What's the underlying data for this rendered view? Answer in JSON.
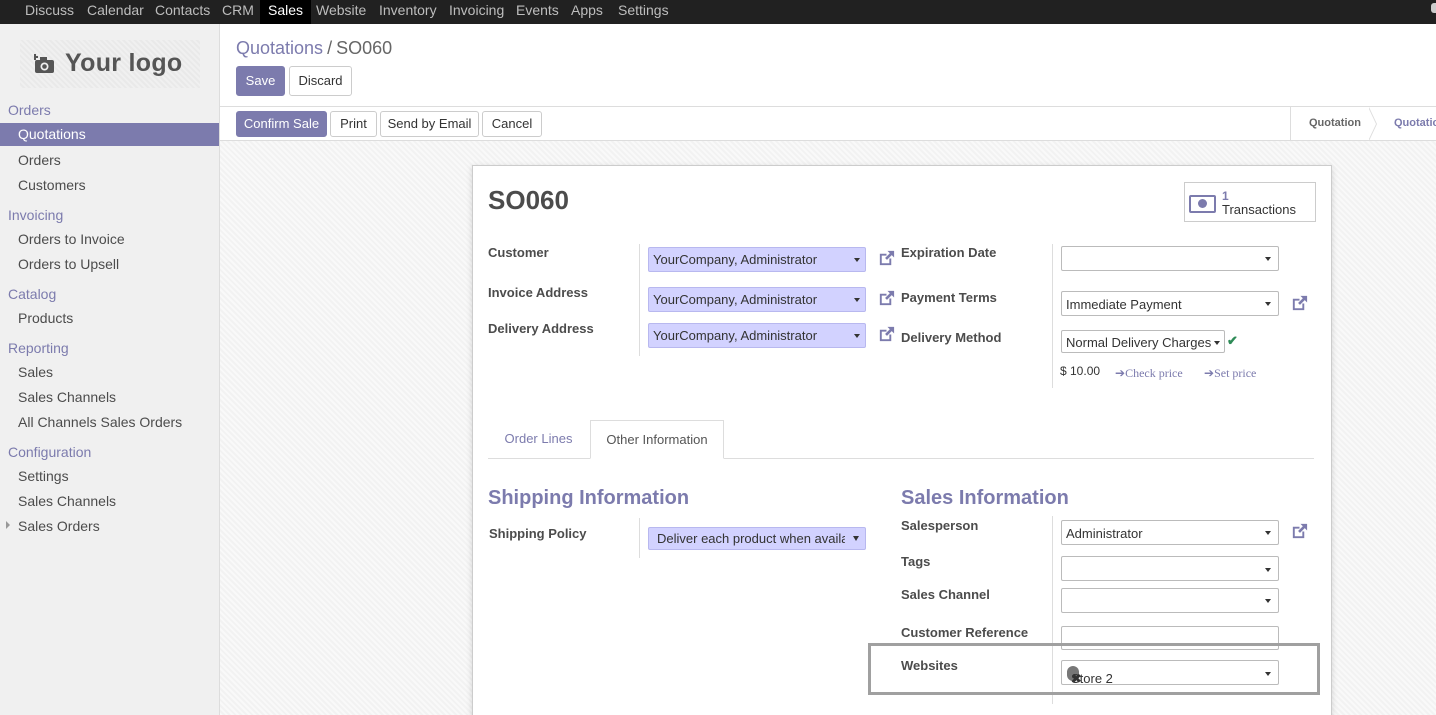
{
  "topnav": {
    "items": [
      "Discuss",
      "Calendar",
      "Contacts",
      "CRM",
      "Sales",
      "Website",
      "Inventory",
      "Invoicing",
      "Events",
      "Apps",
      "Settings"
    ],
    "active": "Sales"
  },
  "logo": {
    "text": "Your logo"
  },
  "sidebar": {
    "sections": [
      {
        "title": "Orders",
        "items": [
          "Quotations",
          "Orders",
          "Customers"
        ]
      },
      {
        "title": "Invoicing",
        "items": [
          "Orders to Invoice",
          "Orders to Upsell"
        ]
      },
      {
        "title": "Catalog",
        "items": [
          "Products"
        ]
      },
      {
        "title": "Reporting",
        "items": [
          "Sales",
          "Sales Channels",
          "All Channels Sales Orders"
        ]
      },
      {
        "title": "Configuration",
        "items": [
          "Settings",
          "Sales Channels",
          "Sales Orders"
        ]
      }
    ],
    "active_item": "Quotations"
  },
  "breadcrumb": {
    "parent": "Quotations",
    "separator": "/",
    "current": "SO060"
  },
  "buttons": {
    "save": "Save",
    "discard": "Discard",
    "confirm": "Confirm Sale",
    "print": "Print",
    "send_email": "Send by Email",
    "cancel": "Cancel"
  },
  "statusbar": {
    "stages": [
      "Quotation",
      "Quotation Sent"
    ]
  },
  "form": {
    "name": "SO060",
    "transactions": {
      "count": "1",
      "label": "Transactions"
    },
    "customer_label": "Customer",
    "customer": "YourCompany, Administrator",
    "invoice_address_label": "Invoice Address",
    "invoice_address": "YourCompany, Administrator",
    "delivery_address_label": "Delivery Address",
    "delivery_address": "YourCompany, Administrator",
    "expiration_date_label": "Expiration Date",
    "expiration_date": "",
    "payment_terms_label": "Payment Terms",
    "payment_terms": "Immediate Payment",
    "delivery_method_label": "Delivery Method",
    "delivery_method": "Normal Delivery Charges",
    "delivery_price": "$ 10.00",
    "check_price": "Check price",
    "set_price": "Set price"
  },
  "tabs": {
    "order_lines": "Order Lines",
    "other_information": "Other Information",
    "active": "Other Information"
  },
  "shipping": {
    "title": "Shipping Information",
    "policy_label": "Shipping Policy",
    "policy": "Deliver each product when available"
  },
  "sales_info": {
    "title": "Sales Information",
    "salesperson_label": "Salesperson",
    "salesperson": "Administrator",
    "tags_label": "Tags",
    "sales_channel_label": "Sales Channel",
    "customer_reference_label": "Customer Reference",
    "websites_label": "Websites",
    "website_tag": "Store 2"
  },
  "colors": {
    "accent": "#7c7bad",
    "topbar": "#212121",
    "m2o_bg": "#d2d2ff",
    "check": "#2e8b57"
  },
  "icons": [
    "camera-icon",
    "external-link-icon",
    "money-icon",
    "dropdown-caret-icon",
    "check-icon",
    "arrow-right-icon",
    "tag-remove-icon",
    "expand-caret-icon"
  ]
}
